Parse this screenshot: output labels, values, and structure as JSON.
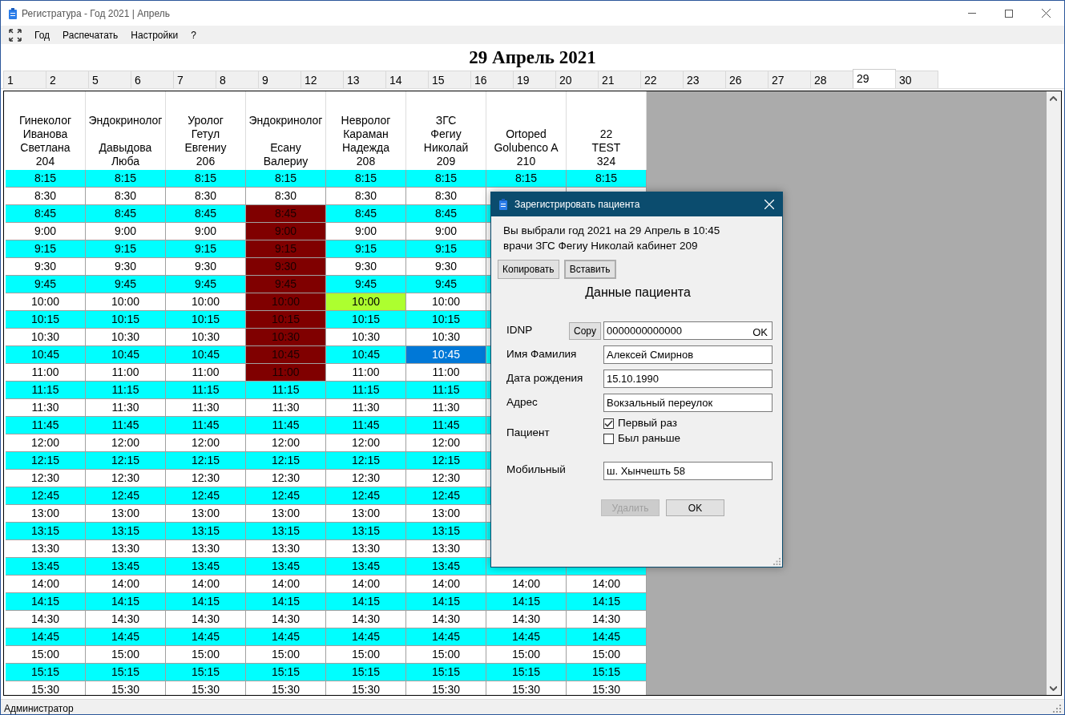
{
  "window": {
    "title": "Регистратура - Год 2021 | Апрель"
  },
  "menu": [
    "Год",
    "Распечатать",
    "Настройки",
    "?"
  ],
  "heading": "29 Апрель 2021",
  "day_tabs": [
    {
      "label": "1",
      "selected": false
    },
    {
      "label": "2",
      "selected": false
    },
    {
      "label": "5",
      "selected": false
    },
    {
      "label": "6",
      "selected": false
    },
    {
      "label": "7",
      "selected": false
    },
    {
      "label": "8",
      "selected": false
    },
    {
      "label": "9",
      "selected": false
    },
    {
      "label": "12",
      "selected": false
    },
    {
      "label": "13",
      "selected": false
    },
    {
      "label": "14",
      "selected": false
    },
    {
      "label": "15",
      "selected": false
    },
    {
      "label": "16",
      "selected": false
    },
    {
      "label": "19",
      "selected": false
    },
    {
      "label": "20",
      "selected": false
    },
    {
      "label": "21",
      "selected": false
    },
    {
      "label": "22",
      "selected": false
    },
    {
      "label": "23",
      "selected": false
    },
    {
      "label": "26",
      "selected": false
    },
    {
      "label": "27",
      "selected": false
    },
    {
      "label": "28",
      "selected": false
    },
    {
      "label": "29",
      "selected": true
    },
    {
      "label": "30",
      "selected": false
    }
  ],
  "schedule": {
    "columns": [
      {
        "lines": [
          "Гинеколог",
          "Иванова",
          "Светлана",
          "204"
        ],
        "gap_after_first": false
      },
      {
        "lines": [
          "Эндокринолог",
          "Давыдова",
          "Люба"
        ],
        "gap_after_first": true
      },
      {
        "lines": [
          "Уролог",
          "Гетул",
          "Евгениу",
          "206"
        ],
        "gap_after_first": false
      },
      {
        "lines": [
          "Эндокринолог",
          "Есану",
          "Валериу"
        ],
        "gap_after_first": true
      },
      {
        "lines": [
          "Невролог",
          "Караман",
          "Надежда",
          "208"
        ],
        "gap_after_first": false
      },
      {
        "lines": [
          "ЗГС",
          "Фегиу",
          "Николай",
          "209"
        ],
        "gap_after_first": false
      },
      {
        "lines": [
          "Ortoped",
          "Golubenco A",
          "210"
        ],
        "gap_after_first": false
      },
      {
        "lines": [
          "22",
          "TEST",
          "324"
        ],
        "gap_after_first": false
      }
    ],
    "rows": [
      {
        "cells": [
          {
            "time": "8:15",
            "kind": "free"
          },
          {
            "time": "8:15",
            "kind": "free"
          },
          {
            "time": "8:15",
            "kind": "free"
          },
          {
            "time": "8:15",
            "kind": "free"
          },
          {
            "time": "8:15",
            "kind": "free"
          },
          {
            "time": "8:15",
            "kind": "free"
          },
          {
            "time": "8:15",
            "kind": "free"
          },
          {
            "time": "8:15",
            "kind": "free"
          }
        ]
      },
      {
        "cells": [
          {
            "time": "8:30",
            "kind": "free"
          },
          {
            "time": "8:30",
            "kind": "free"
          },
          {
            "time": "8:30",
            "kind": "free"
          },
          {
            "time": "8:30",
            "kind": "free"
          },
          {
            "time": "8:30",
            "kind": "free"
          },
          {
            "time": "8:30",
            "kind": "free"
          }
        ]
      },
      {
        "cells": [
          {
            "time": "8:45",
            "kind": "free"
          },
          {
            "time": "8:45",
            "kind": "free"
          },
          {
            "time": "8:45",
            "kind": "free"
          },
          {
            "time": "8:45",
            "kind": "busy"
          },
          {
            "time": "8:45",
            "kind": "free"
          },
          {
            "time": "8:45",
            "kind": "free"
          }
        ]
      },
      {
        "cells": [
          {
            "time": "9:00",
            "kind": "free"
          },
          {
            "time": "9:00",
            "kind": "free"
          },
          {
            "time": "9:00",
            "kind": "free"
          },
          {
            "time": "9:00",
            "kind": "busy"
          },
          {
            "time": "9:00",
            "kind": "free"
          },
          {
            "time": "9:00",
            "kind": "free"
          }
        ]
      },
      {
        "cells": [
          {
            "time": "9:15",
            "kind": "free"
          },
          {
            "time": "9:15",
            "kind": "free"
          },
          {
            "time": "9:15",
            "kind": "free"
          },
          {
            "time": "9:15",
            "kind": "busy"
          },
          {
            "time": "9:15",
            "kind": "free"
          },
          {
            "time": "9:15",
            "kind": "free"
          }
        ]
      },
      {
        "cells": [
          {
            "time": "9:30",
            "kind": "free"
          },
          {
            "time": "9:30",
            "kind": "free"
          },
          {
            "time": "9:30",
            "kind": "free"
          },
          {
            "time": "9:30",
            "kind": "busy"
          },
          {
            "time": "9:30",
            "kind": "free"
          },
          {
            "time": "9:30",
            "kind": "free"
          }
        ]
      },
      {
        "cells": [
          {
            "time": "9:45",
            "kind": "free"
          },
          {
            "time": "9:45",
            "kind": "free"
          },
          {
            "time": "9:45",
            "kind": "free"
          },
          {
            "time": "9:45",
            "kind": "busy"
          },
          {
            "time": "9:45",
            "kind": "free"
          },
          {
            "time": "9:45",
            "kind": "free"
          }
        ]
      },
      {
        "cells": [
          {
            "time": "10:00",
            "kind": "free"
          },
          {
            "time": "10:00",
            "kind": "free"
          },
          {
            "time": "10:00",
            "kind": "free"
          },
          {
            "time": "10:00",
            "kind": "busy"
          },
          {
            "time": "10:00",
            "kind": "booked"
          },
          {
            "time": "10:00",
            "kind": "free"
          }
        ]
      },
      {
        "cells": [
          {
            "time": "10:15",
            "kind": "free"
          },
          {
            "time": "10:15",
            "kind": "free"
          },
          {
            "time": "10:15",
            "kind": "free"
          },
          {
            "time": "10:15",
            "kind": "busy"
          },
          {
            "time": "10:15",
            "kind": "free"
          },
          {
            "time": "10:15",
            "kind": "free"
          }
        ]
      },
      {
        "cells": [
          {
            "time": "10:30",
            "kind": "free"
          },
          {
            "time": "10:30",
            "kind": "free"
          },
          {
            "time": "10:30",
            "kind": "free"
          },
          {
            "time": "10:30",
            "kind": "busy"
          },
          {
            "time": "10:30",
            "kind": "free"
          },
          {
            "time": "10:30",
            "kind": "free"
          }
        ]
      },
      {
        "cells": [
          {
            "time": "10:45",
            "kind": "free"
          },
          {
            "time": "10:45",
            "kind": "free"
          },
          {
            "time": "10:45",
            "kind": "free"
          },
          {
            "time": "10:45",
            "kind": "busy"
          },
          {
            "time": "10:45",
            "kind": "free"
          },
          {
            "time": "10:45",
            "kind": "selected"
          }
        ]
      },
      {
        "cells": [
          {
            "time": "11:00",
            "kind": "free"
          },
          {
            "time": "11:00",
            "kind": "free"
          },
          {
            "time": "11:00",
            "kind": "free"
          },
          {
            "time": "11:00",
            "kind": "busy"
          },
          {
            "time": "11:00",
            "kind": "free"
          },
          {
            "time": "11:00",
            "kind": "free"
          }
        ]
      },
      {
        "cells": [
          {
            "time": "11:15",
            "kind": "free"
          },
          {
            "time": "11:15",
            "kind": "free"
          },
          {
            "time": "11:15",
            "kind": "free"
          },
          {
            "time": "11:15",
            "kind": "free"
          },
          {
            "time": "11:15",
            "kind": "free"
          },
          {
            "time": "11:15",
            "kind": "free"
          }
        ]
      },
      {
        "cells": [
          {
            "time": "11:30",
            "kind": "free"
          },
          {
            "time": "11:30",
            "kind": "free"
          },
          {
            "time": "11:30",
            "kind": "free"
          },
          {
            "time": "11:30",
            "kind": "free"
          },
          {
            "time": "11:30",
            "kind": "free"
          },
          {
            "time": "11:30",
            "kind": "free"
          }
        ]
      },
      {
        "cells": [
          {
            "time": "11:45",
            "kind": "free"
          },
          {
            "time": "11:45",
            "kind": "free"
          },
          {
            "time": "11:45",
            "kind": "free"
          },
          {
            "time": "11:45",
            "kind": "free"
          },
          {
            "time": "11:45",
            "kind": "free"
          },
          {
            "time": "11:45",
            "kind": "free"
          }
        ]
      },
      {
        "cells": [
          {
            "time": "12:00",
            "kind": "free"
          },
          {
            "time": "12:00",
            "kind": "free"
          },
          {
            "time": "12:00",
            "kind": "free"
          },
          {
            "time": "12:00",
            "kind": "free"
          },
          {
            "time": "12:00",
            "kind": "free"
          },
          {
            "time": "12:00",
            "kind": "free"
          }
        ]
      },
      {
        "cells": [
          {
            "time": "12:15",
            "kind": "free"
          },
          {
            "time": "12:15",
            "kind": "free"
          },
          {
            "time": "12:15",
            "kind": "free"
          },
          {
            "time": "12:15",
            "kind": "free"
          },
          {
            "time": "12:15",
            "kind": "free"
          },
          {
            "time": "12:15",
            "kind": "free"
          }
        ]
      },
      {
        "cells": [
          {
            "time": "12:30",
            "kind": "free"
          },
          {
            "time": "12:30",
            "kind": "free"
          },
          {
            "time": "12:30",
            "kind": "free"
          },
          {
            "time": "12:30",
            "kind": "free"
          },
          {
            "time": "12:30",
            "kind": "free"
          },
          {
            "time": "12:30",
            "kind": "free"
          }
        ]
      },
      {
        "cells": [
          {
            "time": "12:45",
            "kind": "free"
          },
          {
            "time": "12:45",
            "kind": "free"
          },
          {
            "time": "12:45",
            "kind": "free"
          },
          {
            "time": "12:45",
            "kind": "free"
          },
          {
            "time": "12:45",
            "kind": "free"
          },
          {
            "time": "12:45",
            "kind": "free"
          }
        ]
      },
      {
        "cells": [
          {
            "time": "13:00",
            "kind": "free"
          },
          {
            "time": "13:00",
            "kind": "free"
          },
          {
            "time": "13:00",
            "kind": "free"
          },
          {
            "time": "13:00",
            "kind": "free"
          },
          {
            "time": "13:00",
            "kind": "free"
          },
          {
            "time": "13:00",
            "kind": "free"
          }
        ]
      },
      {
        "cells": [
          {
            "time": "13:15",
            "kind": "free"
          },
          {
            "time": "13:15",
            "kind": "free"
          },
          {
            "time": "13:15",
            "kind": "free"
          },
          {
            "time": "13:15",
            "kind": "free"
          },
          {
            "time": "13:15",
            "kind": "free"
          },
          {
            "time": "13:15",
            "kind": "free"
          }
        ]
      },
      {
        "cells": [
          {
            "time": "13:30",
            "kind": "free"
          },
          {
            "time": "13:30",
            "kind": "free"
          },
          {
            "time": "13:30",
            "kind": "free"
          },
          {
            "time": "13:30",
            "kind": "free"
          },
          {
            "time": "13:30",
            "kind": "free"
          },
          {
            "time": "13:30",
            "kind": "free"
          }
        ]
      },
      {
        "cells": [
          {
            "time": "13:45",
            "kind": "free"
          },
          {
            "time": "13:45",
            "kind": "free"
          },
          {
            "time": "13:45",
            "kind": "free"
          },
          {
            "time": "13:45",
            "kind": "free"
          },
          {
            "time": "13:45",
            "kind": "free"
          },
          {
            "time": "13:45",
            "kind": "free"
          }
        ]
      },
      {
        "cells": [
          {
            "time": "14:00",
            "kind": "free"
          },
          {
            "time": "14:00",
            "kind": "free"
          },
          {
            "time": "14:00",
            "kind": "free"
          },
          {
            "time": "14:00",
            "kind": "free"
          },
          {
            "time": "14:00",
            "kind": "free"
          },
          {
            "time": "14:00",
            "kind": "free"
          },
          {
            "time": "14:00",
            "kind": "free"
          },
          {
            "time": "14:00",
            "kind": "free"
          }
        ]
      },
      {
        "cells": [
          {
            "time": "14:15",
            "kind": "free"
          },
          {
            "time": "14:15",
            "kind": "free"
          },
          {
            "time": "14:15",
            "kind": "free"
          },
          {
            "time": "14:15",
            "kind": "free"
          },
          {
            "time": "14:15",
            "kind": "free"
          },
          {
            "time": "14:15",
            "kind": "free"
          },
          {
            "time": "14:15",
            "kind": "free"
          },
          {
            "time": "14:15",
            "kind": "free"
          }
        ]
      },
      {
        "cells": [
          {
            "time": "14:30",
            "kind": "free"
          },
          {
            "time": "14:30",
            "kind": "free"
          },
          {
            "time": "14:30",
            "kind": "free"
          },
          {
            "time": "14:30",
            "kind": "free"
          },
          {
            "time": "14:30",
            "kind": "free"
          },
          {
            "time": "14:30",
            "kind": "free"
          },
          {
            "time": "14:30",
            "kind": "free"
          },
          {
            "time": "14:30",
            "kind": "free"
          }
        ]
      },
      {
        "cells": [
          {
            "time": "14:45",
            "kind": "free"
          },
          {
            "time": "14:45",
            "kind": "free"
          },
          {
            "time": "14:45",
            "kind": "free"
          },
          {
            "time": "14:45",
            "kind": "free"
          },
          {
            "time": "14:45",
            "kind": "free"
          },
          {
            "time": "14:45",
            "kind": "free"
          },
          {
            "time": "14:45",
            "kind": "free"
          },
          {
            "time": "14:45",
            "kind": "free"
          }
        ]
      },
      {
        "cells": [
          {
            "time": "15:00",
            "kind": "free"
          },
          {
            "time": "15:00",
            "kind": "free"
          },
          {
            "time": "15:00",
            "kind": "free"
          },
          {
            "time": "15:00",
            "kind": "free"
          },
          {
            "time": "15:00",
            "kind": "free"
          },
          {
            "time": "15:00",
            "kind": "free"
          },
          {
            "time": "15:00",
            "kind": "free"
          },
          {
            "time": "15:00",
            "kind": "free"
          }
        ]
      },
      {
        "cells": [
          {
            "time": "15:15",
            "kind": "free"
          },
          {
            "time": "15:15",
            "kind": "free"
          },
          {
            "time": "15:15",
            "kind": "free"
          },
          {
            "time": "15:15",
            "kind": "free"
          },
          {
            "time": "15:15",
            "kind": "free"
          },
          {
            "time": "15:15",
            "kind": "free"
          },
          {
            "time": "15:15",
            "kind": "free"
          },
          {
            "time": "15:15",
            "kind": "free"
          }
        ]
      },
      {
        "cells": [
          {
            "time": "15:30",
            "kind": "free"
          },
          {
            "time": "15:30",
            "kind": "free"
          },
          {
            "time": "15:30",
            "kind": "free"
          },
          {
            "time": "15:30",
            "kind": "free"
          },
          {
            "time": "15:30",
            "kind": "free"
          },
          {
            "time": "15:30",
            "kind": "free"
          },
          {
            "time": "15:30",
            "kind": "free"
          },
          {
            "time": "15:30",
            "kind": "free"
          }
        ]
      }
    ]
  },
  "dialog": {
    "title": "Зарегистрировать пациента",
    "info_lines": [
      "Вы выбрали год 2021 на 29 Апрель в 10:45",
      "врачи ЗГС Фегиу Николай кабинет 209"
    ],
    "clipboard_buttons": [
      {
        "label": "Копировать",
        "focused": false
      },
      {
        "label": "Вставить",
        "focused": true
      }
    ],
    "section_title": "Данные пациента",
    "fields": [
      {
        "kind": "idnp",
        "label": "IDNP",
        "button": "Copy",
        "value": "0000000000000",
        "status": "OK"
      },
      {
        "kind": "text",
        "label": "Имя Фамилия",
        "value": "Алексей Смирнов"
      },
      {
        "kind": "text",
        "label": "Дата рождения",
        "value": "15.10.1990"
      },
      {
        "kind": "text",
        "label": "Адрес",
        "value": "Вокзальный переулок"
      },
      {
        "kind": "checks",
        "label": "Пациент",
        "options": [
          {
            "label": "Первый раз",
            "checked": true
          },
          {
            "label": "Был раньше",
            "checked": false
          }
        ]
      },
      {
        "kind": "text",
        "label": "Мобильный",
        "value": "ш. Хынчешть 58"
      }
    ],
    "buttons": [
      {
        "label": "Удалить",
        "disabled": true
      },
      {
        "label": "OK",
        "disabled": false
      }
    ]
  },
  "status_bar": "Администратор"
}
